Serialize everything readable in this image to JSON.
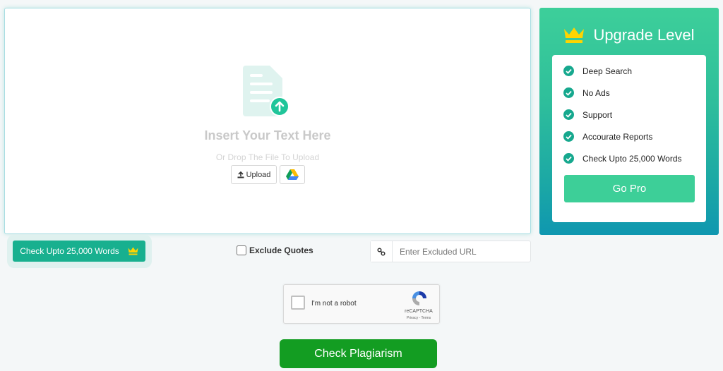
{
  "editor": {
    "title": "Insert Your Text Here",
    "subtitle": "Or Drop The File To Upload",
    "upload_label": "Upload",
    "icons": {
      "document": "document-upload-icon",
      "upload": "upload-icon",
      "drive": "google-drive-icon"
    }
  },
  "upgrade": {
    "title": "Upgrade Level",
    "icon": "crown-icon",
    "features": [
      "Deep Search",
      "No Ads",
      "Support",
      "Accourate Reports",
      "Check Upto 25,000 Words"
    ],
    "cta_label": "Go Pro"
  },
  "toolbar": {
    "words_label": "Check Upto 25,000 Words",
    "exclude_quotes_label": "Exclude Quotes",
    "exclude_quotes_checked": false,
    "url_placeholder": "Enter Excluded URL",
    "url_value": "",
    "url_icon": "link-icon"
  },
  "recaptcha": {
    "label": "I'm not a robot",
    "brand": "reCAPTCHA",
    "links": "Privacy - Terms"
  },
  "submit": {
    "label": "Check Plagiarism"
  },
  "colors": {
    "accent": "#3dcf98",
    "teal": "#18b08f",
    "submit_green": "#139d22",
    "crown_yellow": "#ffd400"
  }
}
